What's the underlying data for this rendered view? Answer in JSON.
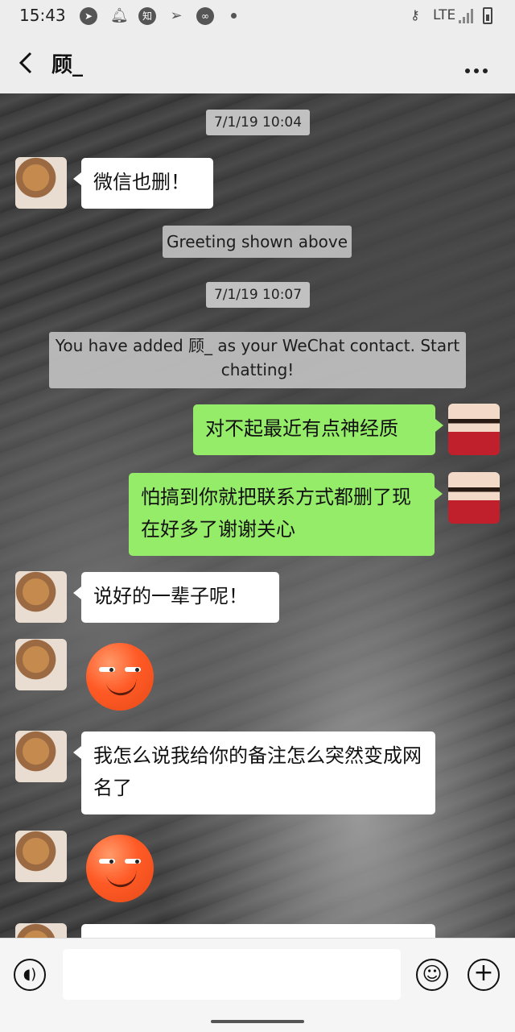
{
  "status_bar": {
    "time": "15:43",
    "icons": [
      "telegram-icon",
      "notification-bell-icon",
      "zhihu-icon",
      "send-arrow-icon",
      "loop-icon"
    ],
    "network": "LTE",
    "zhihu_glyph": "知"
  },
  "header": {
    "title": "顾_",
    "back_icon": "chevron-left-icon",
    "more_icon": "more-dots-icon"
  },
  "chat": {
    "messages": [
      {
        "type": "time",
        "text": "7/1/19 10:04"
      },
      {
        "type": "received",
        "text": "微信也删！"
      },
      {
        "type": "system",
        "text": "Greeting shown above"
      },
      {
        "type": "time",
        "text": "7/1/19 10:07"
      },
      {
        "type": "system",
        "text": "You have added 顾_ as your WeChat contact. Start chatting!"
      },
      {
        "type": "sent",
        "text": "对不起最近有点神经质"
      },
      {
        "type": "sent",
        "text": "怕搞到你就把联系方式都删了现在好多了谢谢关心"
      },
      {
        "type": "received",
        "text": "说好的一辈子呢！"
      },
      {
        "type": "received_sticker",
        "sticker": "smirk-emoji"
      },
      {
        "type": "received",
        "text": "我怎么说我给你的备注怎么突然变成网名了"
      },
      {
        "type": "received_sticker",
        "sticker": "smirk-emoji"
      }
    ]
  },
  "input_bar": {
    "voice_icon": "voice-icon",
    "emoji_icon": "emoji-icon",
    "plus_icon": "plus-icon",
    "text_value": ""
  },
  "colors": {
    "sent_bubble": "#95ec69",
    "received_bubble": "#ffffff",
    "chrome": "#ededed"
  }
}
